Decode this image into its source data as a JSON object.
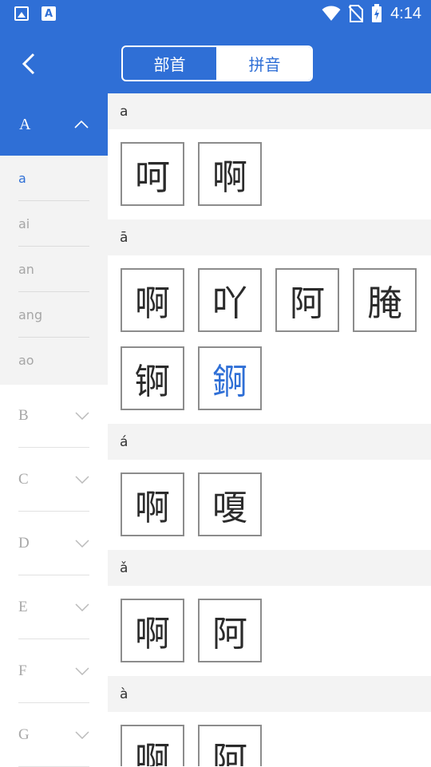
{
  "status_bar": {
    "time": "4:14",
    "icons": [
      "image-icon",
      "font-app-icon",
      "wifi-icon",
      "no-sim-icon",
      "battery-icon"
    ]
  },
  "header": {
    "back_icon": "back-arrow-icon",
    "tabs": [
      {
        "label": "部首",
        "active": false
      },
      {
        "label": "拼音",
        "active": true
      }
    ]
  },
  "sidebar": {
    "active_letter": "A",
    "sub_items": [
      "a",
      "ai",
      "an",
      "ang",
      "ao"
    ],
    "letters": [
      "B",
      "C",
      "D",
      "E",
      "F",
      "G"
    ]
  },
  "sections": [
    {
      "pinyin": "a",
      "chars": [
        "呵",
        "啊"
      ]
    },
    {
      "pinyin": "ā",
      "chars": [
        "啊",
        "吖",
        "阿",
        "腌",
        "锕",
        "錒"
      ]
    },
    {
      "pinyin": "á",
      "chars": [
        "啊",
        "嗄"
      ]
    },
    {
      "pinyin": "ǎ",
      "chars": [
        "啊",
        "阿"
      ]
    },
    {
      "pinyin": "à",
      "chars": [
        "啊",
        "阿"
      ]
    }
  ],
  "colors": {
    "accent": "#2f6fd6",
    "highlight_char": "#2f6fd6"
  }
}
